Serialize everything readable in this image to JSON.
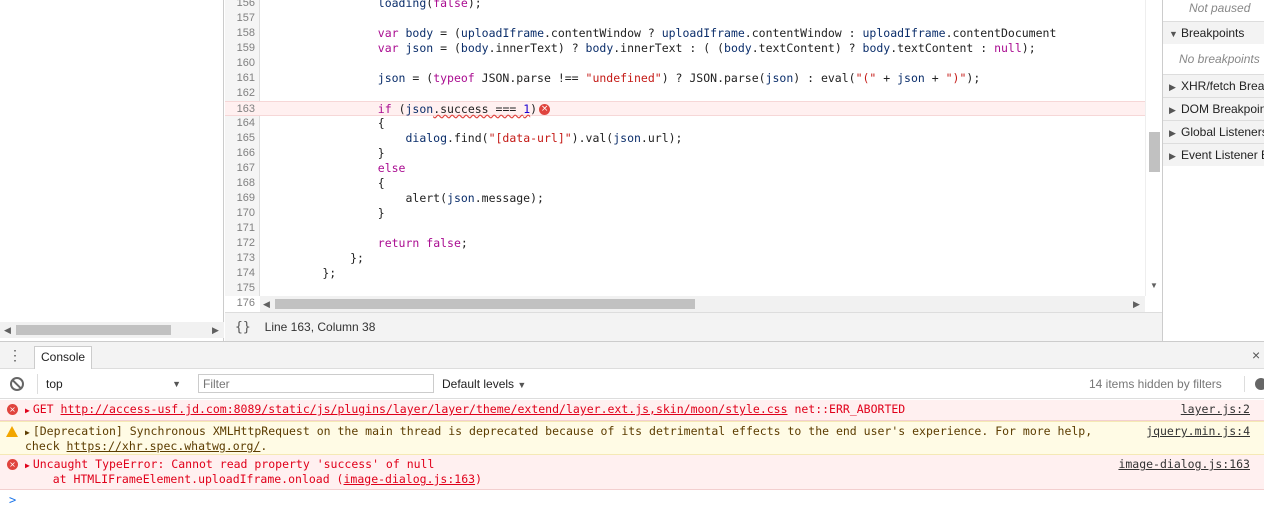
{
  "editor": {
    "lines": [
      {
        "n": "156",
        "html": "                <span class=\"var\">loading</span>(<span class=\"kw\">false</span>);",
        "hl": false
      },
      {
        "n": "157",
        "html": "",
        "hl": false
      },
      {
        "n": "158",
        "html": "                <span class=\"kw\">var</span> <span class=\"var\">body</span> = (<span class=\"var\">uploadIframe</span>.contentWindow ? <span class=\"var\">uploadIframe</span>.contentWindow : <span class=\"var\">uploadIframe</span>.contentDocument",
        "hl": false
      },
      {
        "n": "159",
        "html": "                <span class=\"kw\">var</span> <span class=\"var\">json</span> = (<span class=\"var\">body</span>.innerText) ? <span class=\"var\">body</span>.innerText : ( (<span class=\"var\">body</span>.textContent) ? <span class=\"var\">body</span>.textContent : <span class=\"kw\">null</span>);",
        "hl": false
      },
      {
        "n": "160",
        "html": "",
        "hl": false
      },
      {
        "n": "161",
        "html": "                <span class=\"var\">json</span> = (<span class=\"kw\">typeof</span> JSON.parse !== <span class=\"str\">\"undefined\"</span>) ? JSON.parse(<span class=\"var\">json</span>) : eval(<span class=\"str\">\"(\"</span> + <span class=\"var\">json</span> + <span class=\"str\">\")\"</span>);",
        "hl": false
      },
      {
        "n": "162",
        "html": "",
        "hl": false
      },
      {
        "n": "163",
        "html": "                <span class=\"kw\">if</span> (<span class=\"var\">json</span><span class=\"squig\">.success === <span class=\"num\">1</span></span>)<span class=\"err-dot\">×</span>",
        "hl": true
      },
      {
        "n": "164",
        "html": "                {",
        "hl": false
      },
      {
        "n": "165",
        "html": "                    <span class=\"var\">dialog</span>.find(<span class=\"str\">\"[data-url]\"</span>).val(<span class=\"var\">json</span>.url);",
        "hl": false
      },
      {
        "n": "166",
        "html": "                }",
        "hl": false
      },
      {
        "n": "167",
        "html": "                <span class=\"kw\">else</span>",
        "hl": false
      },
      {
        "n": "168",
        "html": "                {",
        "hl": false
      },
      {
        "n": "169",
        "html": "                    alert(<span class=\"var\">json</span>.message);",
        "hl": false
      },
      {
        "n": "170",
        "html": "                }",
        "hl": false
      },
      {
        "n": "171",
        "html": "",
        "hl": false
      },
      {
        "n": "172",
        "html": "                <span class=\"kw\">return</span> <span class=\"kw\">false</span>;",
        "hl": false
      },
      {
        "n": "173",
        "html": "            };",
        "hl": false
      },
      {
        "n": "174",
        "html": "        };",
        "hl": false
      },
      {
        "n": "175",
        "html": "",
        "hl": false
      },
      {
        "n": "176",
        "html": "",
        "hl": false
      }
    ]
  },
  "status": {
    "braces": "{}",
    "position": "Line 163, Column 38"
  },
  "sidebar": {
    "not_paused": "Not paused",
    "breakpoints": "Breakpoints",
    "no_breakpoints": "No breakpoints",
    "xhr": "XHR/fetch Breakpoints",
    "dom": "DOM Breakpoints",
    "global": "Global Listeners",
    "event": "Event Listener Breakpoints"
  },
  "drawer": {
    "menu_icon": "⋮",
    "tab": "Console",
    "close_icon": "×"
  },
  "toolbar": {
    "context": "top",
    "filter_placeholder": "Filter",
    "levels": "Default levels",
    "hidden": "14 items hidden by filters"
  },
  "messages": [
    {
      "level": "error",
      "prefix": "GET ",
      "url": "http://access-usf.jd.com:8089/static/js/plugins/layer/layer/theme/extend/layer.ext.js,skin/moon/style.css",
      "suffix": " net::ERR_ABORTED",
      "source": "layer.js:2"
    },
    {
      "level": "warning",
      "line1": "[Deprecation] Synchronous XMLHttpRequest on the main thread is deprecated because of its detrimental effects to the end user's experience. For more help,",
      "line2_prefix": "check ",
      "line2_link": "https://xhr.spec.whatwg.org/",
      "line2_suffix": ".",
      "source": "jquery.min.js:4"
    },
    {
      "level": "error",
      "line1": "Uncaught TypeError: Cannot read property 'success' of null",
      "line2_prefix": "    at HTMLIFrameElement.uploadIframe.onload (",
      "line2_link": "image-dialog.js:163",
      "line2_suffix": ")",
      "source": "image-dialog.js:163"
    }
  ],
  "prompt": {
    "chevron": ">"
  }
}
